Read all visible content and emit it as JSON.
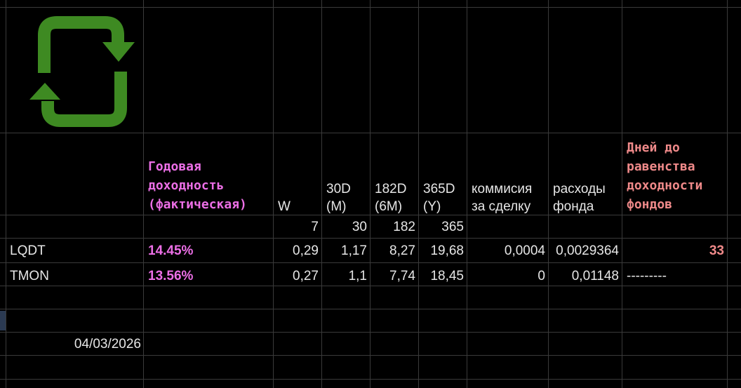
{
  "sheet": {
    "icon": "refresh-cycle-icon",
    "colors": {
      "background": "#000000",
      "grid": "#3a3a3a",
      "text": "#e6e6e6",
      "accent_pink": "#ec6fe6",
      "accent_salmon": "#f08a8a",
      "icon_green": "#3e8a22"
    },
    "headers": {
      "annual_yield": "Годовая доходность (фактическая)",
      "w": "W",
      "d30": "30D (M)",
      "d182": "182D (6M)",
      "d365": "365D (Y)",
      "commission": "коммисия за сделку",
      "fund_expenses": "расходы фонда",
      "days_to_parity": "Дней до равенства доходности фондов"
    },
    "periods": {
      "w": "7",
      "d30": "30",
      "d182": "182",
      "d365": "365"
    },
    "rows": [
      {
        "ticker": "LQDT",
        "annual_yield": "14.45%",
        "w": "0,29",
        "d30": "1,17",
        "d182": "8,27",
        "d365": "19,68",
        "commission": "0,0004",
        "fund_expenses": "0,0029364",
        "days_to_parity": "33"
      },
      {
        "ticker": "TMON",
        "annual_yield": "13.56%",
        "w": "0,27",
        "d30": "1,1",
        "d182": "7,74",
        "d365": "18,45",
        "commission": "0",
        "fund_expenses": "0,01148",
        "days_to_parity": "---------"
      }
    ],
    "date": "04/03/2026"
  }
}
